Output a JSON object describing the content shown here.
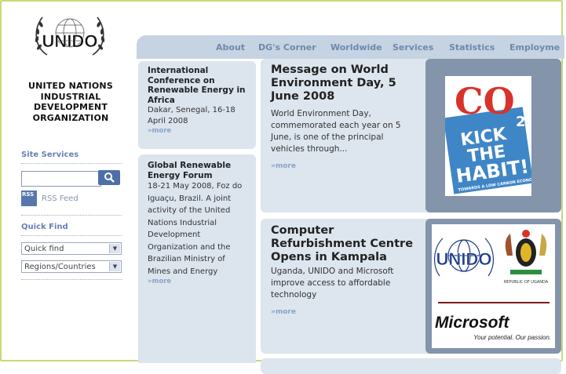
{
  "org": {
    "logo_text": "UNIDO",
    "name_lines": [
      "UNITED NATIONS",
      "INDUSTRIAL",
      "DEVELOPMENT",
      "ORGANIZATION"
    ]
  },
  "sidebar": {
    "site_services": "Site Services",
    "search_placeholder": "",
    "rss_icon_text": "RSS",
    "rss_label": "RSS Feed",
    "quick_find_heading": "Quick Find",
    "select_quick_find": "Quick find",
    "select_regions": "Regions/Countries"
  },
  "nav": {
    "items": [
      "About",
      "DG's Corner",
      "Worldwide",
      "Services",
      "Statistics",
      "Employme"
    ]
  },
  "events": [
    {
      "title": "International Conference on Renewable Energy in Africa",
      "text": "Dakar, Senegal, 16-18 April 2008",
      "more": "»more"
    },
    {
      "title": "Global Renewable Energy Forum",
      "text": "18-21 May 2008, Foz do Iguaçu, Brazil. A joint activity of the United Nations Industrial Development Organization and the Brazilian Ministry of Mines and Energy",
      "more": "»more"
    }
  ],
  "features": [
    {
      "title": "Message on World Environment Day, 5 June 2008",
      "text": "World Environment Day, commemorated each year on 5 June, is one of the principal vehicles through...",
      "more": "»more",
      "image": {
        "line1": "CO",
        "sub": "2",
        "line2": "KICK",
        "line3": "THE",
        "line4": "HABIT!",
        "tag": "TOWARDS A LOW CARBON ECONOMY"
      }
    },
    {
      "title": "Computer Refurbishment Centre Opens in Kampala",
      "text": "Uganda, UNIDO and Microsoft improve access to affordable technology",
      "more": "»more",
      "image": {
        "unido": "UNIDO",
        "uganda": "REPUBLIC OF UGANDA",
        "brand": "Microsoft",
        "slogan": "Your potential. Our passion."
      }
    }
  ],
  "colors": {
    "frame": "#c8d97a",
    "nav_bg": "#c6d3e2",
    "nav_text": "#6e89ad",
    "card_bg": "#dce4ee",
    "accent_blue": "#4d6fa8",
    "co2_red": "#d8332a",
    "co2_blue": "#3f86c6"
  }
}
